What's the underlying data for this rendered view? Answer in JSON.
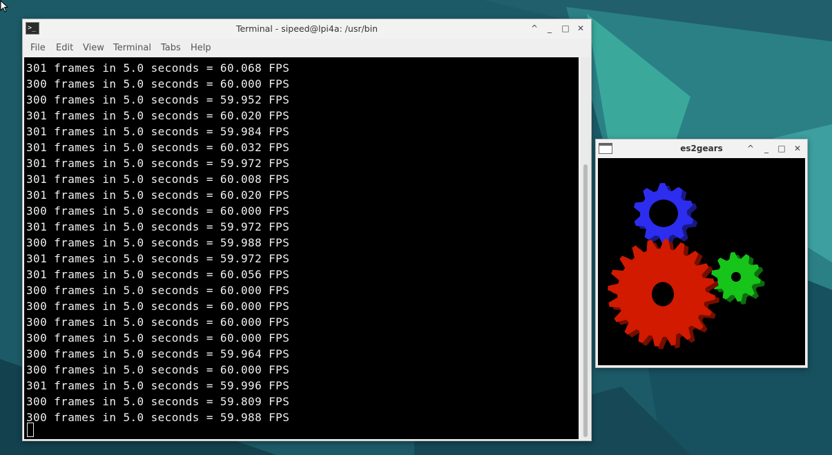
{
  "desktop": {
    "background_colors": [
      "#1f5f6a",
      "#2b7f85",
      "#3aa79c",
      "#0f3d4c"
    ]
  },
  "terminal": {
    "title": "Terminal - sipeed@lpi4a: /usr/bin",
    "app_icon_glyph": ">_",
    "menu": [
      "File",
      "Edit",
      "View",
      "Terminal",
      "Tabs",
      "Help"
    ],
    "lines": [
      "301 frames in 5.0 seconds = 60.068 FPS",
      "300 frames in 5.0 seconds = 60.000 FPS",
      "300 frames in 5.0 seconds = 59.952 FPS",
      "301 frames in 5.0 seconds = 60.020 FPS",
      "301 frames in 5.0 seconds = 59.984 FPS",
      "301 frames in 5.0 seconds = 60.032 FPS",
      "301 frames in 5.0 seconds = 59.972 FPS",
      "301 frames in 5.0 seconds = 60.008 FPS",
      "301 frames in 5.0 seconds = 60.020 FPS",
      "300 frames in 5.0 seconds = 60.000 FPS",
      "301 frames in 5.0 seconds = 59.972 FPS",
      "300 frames in 5.0 seconds = 59.988 FPS",
      "301 frames in 5.0 seconds = 59.972 FPS",
      "301 frames in 5.0 seconds = 60.056 FPS",
      "300 frames in 5.0 seconds = 60.000 FPS",
      "300 frames in 5.0 seconds = 60.000 FPS",
      "300 frames in 5.0 seconds = 60.000 FPS",
      "300 frames in 5.0 seconds = 60.000 FPS",
      "300 frames in 5.0 seconds = 59.964 FPS",
      "300 frames in 5.0 seconds = 60.000 FPS",
      "301 frames in 5.0 seconds = 59.996 FPS",
      "300 frames in 5.0 seconds = 59.809 FPS",
      "300 frames in 5.0 seconds = 59.988 FPS"
    ],
    "window_buttons": [
      "^",
      "_",
      "□",
      "✕"
    ]
  },
  "gears_window": {
    "title": "es2gears",
    "window_buttons": [
      "^",
      "_",
      "□",
      "✕"
    ],
    "gear_colors": {
      "blue": "#2d2df0",
      "red": "#d21a00",
      "green": "#17c41a"
    }
  }
}
